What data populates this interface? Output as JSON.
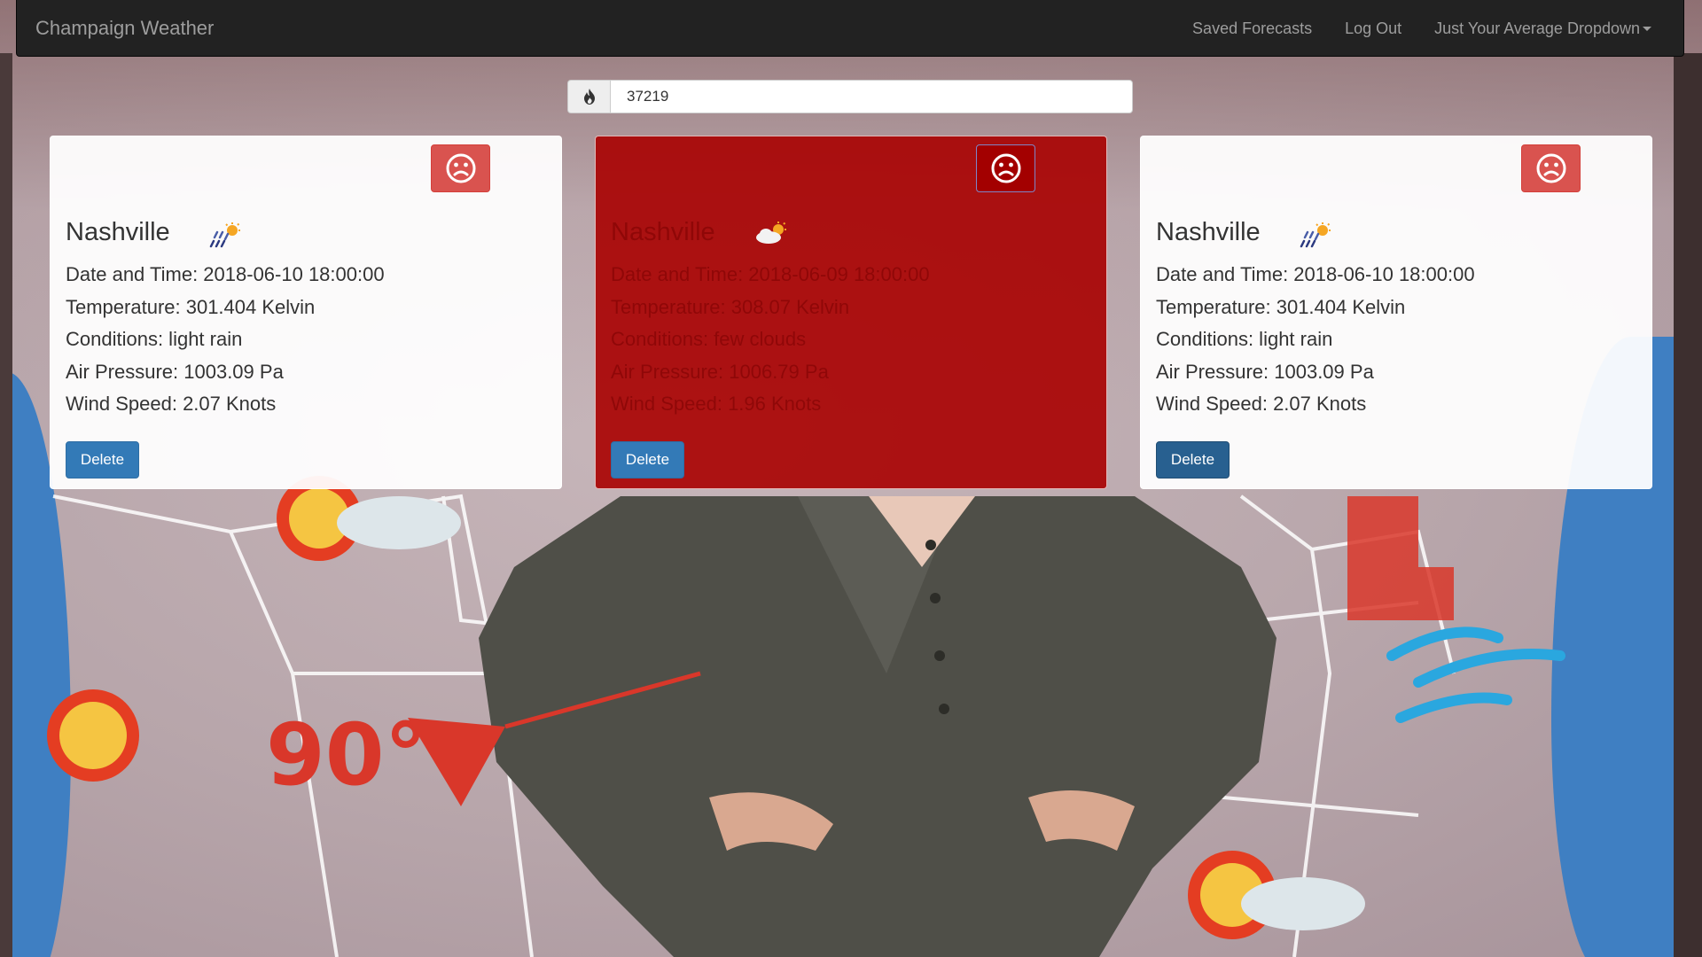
{
  "navbar": {
    "brand": "Champaign Weather",
    "links": [
      "Saved Forecasts",
      "Log Out"
    ],
    "dropdown_label": "Just Your Average Dropdown"
  },
  "search": {
    "value": "37219",
    "icon": "fire-icon"
  },
  "cards": [
    {
      "city": "Nashville",
      "weather_icon": "rain-sun-icon",
      "date_time": "Date and Time: 2018-06-10 18:00:00",
      "temperature": "Temperature: 301.404 Kelvin",
      "conditions": "Conditions: light rain",
      "air_pressure": "Air Pressure: 1003.09 Pa",
      "wind_speed": "Wind Speed: 2.07 Knots",
      "action_icon": "sad-face-icon",
      "delete_label": "Delete"
    },
    {
      "city": "Nashville",
      "weather_icon": "few-clouds-icon",
      "date_time": "Date and Time: 2018-06-09 18:00:00",
      "temperature": "Temperature: 308.07 Kelvin",
      "conditions": "Conditions: few clouds",
      "air_pressure": "Air Pressure: 1006.79 Pa",
      "wind_speed": "Wind Speed: 1.96 Knots",
      "action_icon": "sad-face-icon",
      "delete_label": "Delete"
    },
    {
      "city": "Nashville",
      "weather_icon": "rain-sun-icon",
      "date_time": "Date and Time: 2018-06-10 18:00:00",
      "temperature": "Temperature: 301.404 Kelvin",
      "conditions": "Conditions: light rain",
      "air_pressure": "Air Pressure: 1003.09 Pa",
      "wind_speed": "Wind Speed: 2.07 Knots",
      "action_icon": "sad-face-icon",
      "delete_label": "Delete"
    }
  ],
  "background": {
    "map_temp_label": "90°",
    "colors": {
      "navbar": "#222222",
      "primary_button": "#337ab7",
      "danger_button": "#d9534f",
      "highlight_card": "#a80000",
      "ocean": "#3f7fc2"
    }
  }
}
